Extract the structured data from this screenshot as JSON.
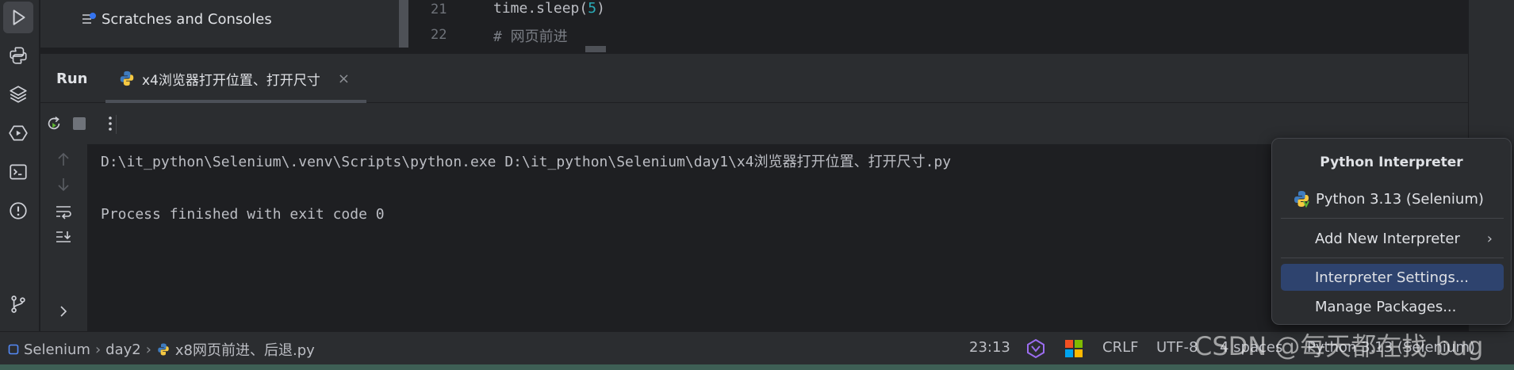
{
  "toolstrip": {
    "items": [
      "run-icon",
      "python-console-icon",
      "layers-icon",
      "services-icon",
      "terminal-icon",
      "problems-icon",
      "git-icon"
    ]
  },
  "project": {
    "scratches_label": "Scratches and Consoles"
  },
  "editor": {
    "lines": [
      {
        "num": "21",
        "text": "time.sleep(",
        "arg": "5",
        "close": ")"
      },
      {
        "num": "22",
        "comment": "# 网页前进"
      }
    ]
  },
  "run": {
    "title": "Run",
    "tab_label": "x4浏览器打开位置、打开尺寸",
    "tab_close": "×",
    "console": [
      "D:\\it_python\\Selenium\\.venv\\Scripts\\python.exe D:\\it_python\\Selenium\\day1\\x4浏览器打开位置、打开尺寸.py",
      "",
      "Process finished with exit code 0"
    ]
  },
  "popup": {
    "title": "Python Interpreter",
    "current": "Python 3.13 (Selenium)",
    "add_new": "Add New Interpreter",
    "settings": "Interpreter Settings...",
    "manage": "Manage Packages..."
  },
  "statusbar": {
    "project": "Selenium",
    "folder": "day2",
    "file": "x8网页前进、后退.py",
    "position": "23:13",
    "line_sep": "CRLF",
    "encoding": "UTF-8",
    "indent": "4 spaces",
    "interpreter": "Python 3.13 (Selenium)"
  },
  "watermark": "CSDN @每天都在找 bug",
  "colors": {
    "accent": "#2e436e",
    "background": "#1e1f22",
    "panel": "#2b2d30"
  }
}
